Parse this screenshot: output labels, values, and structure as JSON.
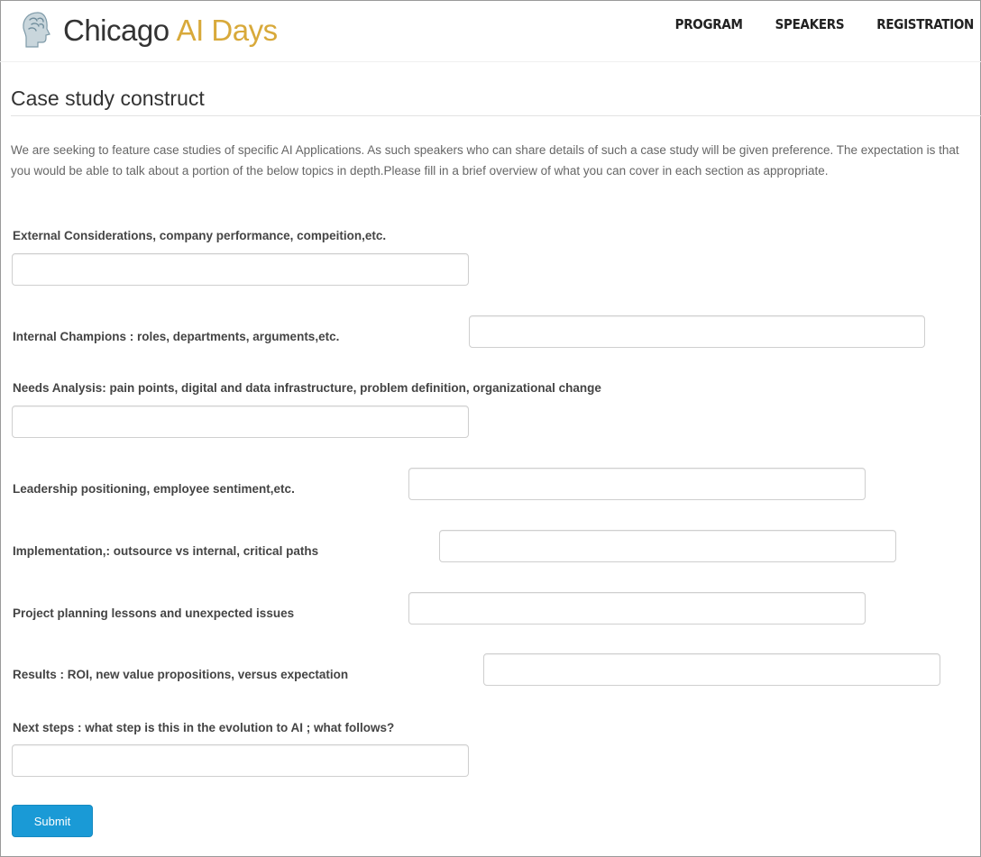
{
  "header": {
    "logo_word1": "Chicago",
    "logo_word2": "AI Days",
    "nav": [
      "PROGRAM",
      "SPEAKERS",
      "REGISTRATION"
    ]
  },
  "page": {
    "title": "Case study construct",
    "intro": "We are seeking to feature case studies of specific AI Applications. As such speakers who can share details of such a case study will be given preference. The expectation is that you would be able to talk about a portion of the below topics in depth.Please fill in a brief overview of what you can cover in each section as appropriate."
  },
  "fields": [
    {
      "label": "External Considerations, company performance, compeition,etc.",
      "value": ""
    },
    {
      "label": "Internal Champions : roles, departments, arguments,etc.",
      "value": ""
    },
    {
      "label": "Needs Analysis: pain points, digital and data infrastructure, problem definition, organizational change",
      "value": ""
    },
    {
      "label": "Leadership positioning, employee sentiment,etc.",
      "value": ""
    },
    {
      "label": "Implementation,: outsource vs internal, critical paths",
      "value": ""
    },
    {
      "label": "Project planning lessons and unexpected issues",
      "value": ""
    },
    {
      "label": "Results : ROI, new value propositions, versus expectation",
      "value": ""
    },
    {
      "label": "Next steps : what step is this in the evolution to AI ; what follows?",
      "value": ""
    }
  ],
  "form": {
    "submit_label": "Submit"
  },
  "colors": {
    "brand_gold": "#d8a93a",
    "submit_blue": "#1a9ad6"
  }
}
